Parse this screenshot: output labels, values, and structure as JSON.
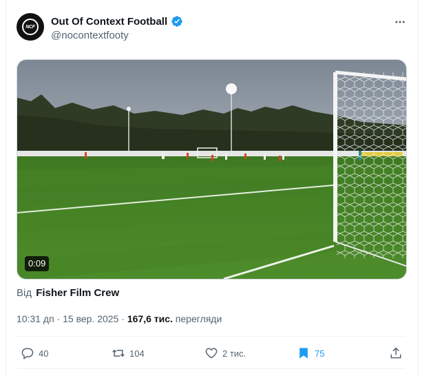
{
  "author": {
    "display_name": "Out Of Context Football",
    "handle": "@nocontextfooty",
    "avatar_text": "NCF",
    "verified": true
  },
  "media": {
    "duration": "0:09"
  },
  "source": {
    "prefix": "Від",
    "name": "Fisher Film Crew"
  },
  "meta": {
    "time": "10:31 дп",
    "separator": "·",
    "date": "15 вер. 2025",
    "views_count": "167,6 тис.",
    "views_label": "перегляди"
  },
  "actions": {
    "replies": "40",
    "reposts": "104",
    "likes": "2 тис.",
    "bookmarks": "75"
  },
  "colors": {
    "accent": "#1d9bf0",
    "text_secondary": "#536471",
    "text_primary": "#0f1419"
  }
}
